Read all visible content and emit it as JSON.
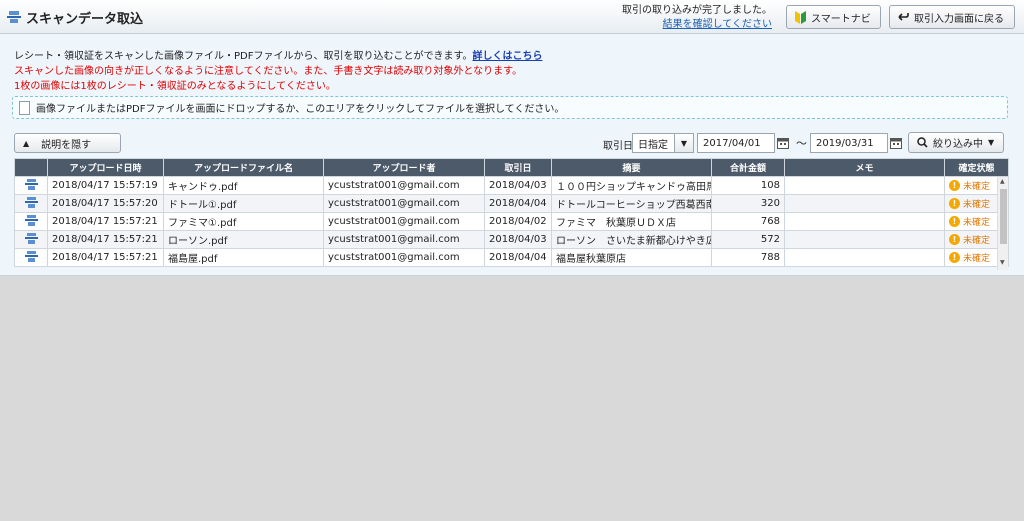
{
  "header": {
    "title": "スキャンデータ取込",
    "notice_line1": "取引の取り込みが完了しました。",
    "notice_link": "結果を確認してください",
    "smart_navi": "スマートナビ",
    "back_button": "取引入力画面に戻る"
  },
  "description": {
    "line1": "レシート・領収証をスキャンした画像ファイル・PDFファイルから、取引を取り込むことができます。",
    "detail_link": "詳しくはこちら",
    "warning1": "スキャンした画像の向きが正しくなるように注意してください。また、手書き文字は読み取り対象外となります。",
    "warning2": "1枚の画像には1枚のレシート・領収証のみとなるようにしてください。"
  },
  "dropzone": {
    "text": "画像ファイルまたはPDFファイルを画面にドロップするか、このエリアをクリックしてファイルを選択してください。"
  },
  "toolbar": {
    "hide_desc": "説明を隠す",
    "date_label": "取引日",
    "date_mode": "日指定",
    "date_from": "2017/04/01",
    "tilde": "～",
    "date_to": "2019/03/31",
    "filter": "絞り込み中"
  },
  "table": {
    "headers": [
      "",
      "アップロード日時",
      "アップロードファイル名",
      "アップロード者",
      "取引日",
      "摘要",
      "合計金額",
      "メモ",
      "確定状態"
    ],
    "rows": [
      {
        "uploaded": "2018/04/17 15:57:19",
        "file": "キャンドゥ.pdf",
        "user": "ycuststrat001@gmail.com",
        "date": "2018/04/03",
        "summary": "１００円ショップキャンドゥ高田馬…",
        "amount": "108",
        "memo": "",
        "status": "未確定"
      },
      {
        "uploaded": "2018/04/17 15:57:20",
        "file": "ドトール①.pdf",
        "user": "ycuststrat001@gmail.com",
        "date": "2018/04/04",
        "summary": "ドトールコーヒーショップ西葛西南…",
        "amount": "320",
        "memo": "",
        "status": "未確定"
      },
      {
        "uploaded": "2018/04/17 15:57:21",
        "file": "ファミマ①.pdf",
        "user": "ycuststrat001@gmail.com",
        "date": "2018/04/02",
        "summary": "ファミマ　秋葉原ＵＤＸ店",
        "amount": "768",
        "memo": "",
        "status": "未確定"
      },
      {
        "uploaded": "2018/04/17 15:57:21",
        "file": "ローソン.pdf",
        "user": "ycuststrat001@gmail.com",
        "date": "2018/04/03",
        "summary": "ローソン　さいたま新都心けやき広…",
        "amount": "572",
        "memo": "",
        "status": "未確定"
      },
      {
        "uploaded": "2018/04/17 15:57:21",
        "file": "福島屋.pdf",
        "user": "ycuststrat001@gmail.com",
        "date": "2018/04/04",
        "summary": "福島屋秋葉原店",
        "amount": "788",
        "memo": "",
        "status": "未確定"
      }
    ]
  }
}
